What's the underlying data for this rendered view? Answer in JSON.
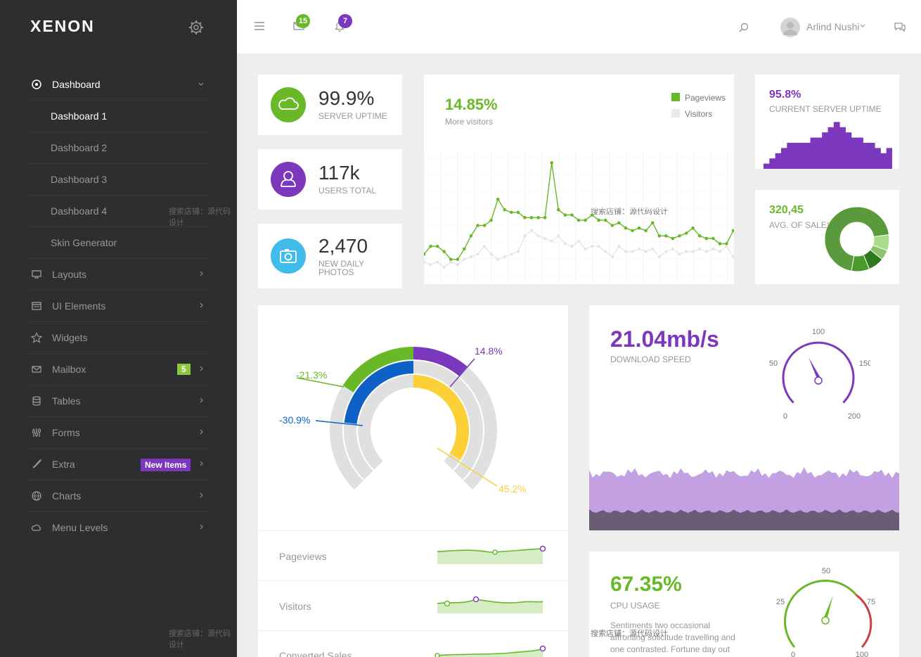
{
  "brand": {
    "logo": "XENON"
  },
  "sidebar": {
    "items": [
      {
        "label": "Dashboard",
        "icon": "gauge-icon"
      },
      {
        "label": "Dashboard 1"
      },
      {
        "label": "Dashboard 2"
      },
      {
        "label": "Dashboard 3"
      },
      {
        "label": "Dashboard 4"
      },
      {
        "label": "Skin Generator"
      },
      {
        "label": "Layouts",
        "icon": "monitor-icon"
      },
      {
        "label": "UI Elements",
        "icon": "window-icon"
      },
      {
        "label": "Widgets",
        "icon": "star-icon"
      },
      {
        "label": "Mailbox",
        "icon": "envelope-icon",
        "badge": "5"
      },
      {
        "label": "Tables",
        "icon": "database-icon"
      },
      {
        "label": "Forms",
        "icon": "sliders-icon"
      },
      {
        "label": "Extra",
        "icon": "rocket-icon",
        "badge": "New Items"
      },
      {
        "label": "Charts",
        "icon": "globe-icon"
      },
      {
        "label": "Menu Levels",
        "icon": "cloud-icon"
      }
    ]
  },
  "topbar": {
    "mail_count": "15",
    "bell_count": "7",
    "user_name": "Arlind Nushi"
  },
  "stats": {
    "uptime": {
      "value": "99.9%",
      "label": "SERVER UPTIME"
    },
    "users": {
      "value": "117k",
      "label": "USERS TOTAL"
    },
    "photos": {
      "value": "2,470",
      "label1": "NEW DAILY",
      "label2": "PHOTOS"
    }
  },
  "visitors_chart": {
    "pct": "14.85%",
    "sub": "More visitors",
    "legend": [
      "Pageviews",
      "Visitors"
    ]
  },
  "server_uptime": {
    "pct": "95.8%",
    "label": "CURRENT SERVER UPTIME"
  },
  "sales": {
    "value": "320,45",
    "label": "AVG. OF SALES"
  },
  "radial": {
    "labels": [
      "-21.3%",
      "14.8%",
      "-30.9%",
      "45.2%"
    ]
  },
  "sparks": {
    "rows": [
      "Pageviews",
      "Visitors",
      "Converted Sales"
    ]
  },
  "download": {
    "value": "21.04mb/s",
    "label": "DOWNLOAD SPEED",
    "ticks": [
      "100",
      "50",
      "150",
      "0",
      "200"
    ]
  },
  "cpu": {
    "value": "67.35%",
    "label": "CPU USAGE",
    "text": "Sentiments two occasional affronting solicitude travelling and one contrasted. Fortune day out",
    "ticks": [
      "50",
      "25",
      "75",
      "0",
      "100"
    ]
  },
  "watermark": "搜索店铺：源代码设计",
  "colors": {
    "green": "#68b828",
    "purple": "#7c38bc",
    "blue": "#0e62c7",
    "yellow": "#fcd036",
    "cyan": "#40bbea"
  },
  "chart_data": [
    {
      "type": "line",
      "series": [
        {
          "name": "Pageviews",
          "values": [
            23,
            26,
            26,
            24,
            21,
            21,
            25,
            30,
            34,
            34,
            36,
            44,
            40,
            39,
            39,
            37,
            37,
            37,
            37,
            58,
            40,
            38,
            38,
            36,
            36,
            38,
            36,
            36,
            34,
            35,
            33,
            32,
            33,
            32,
            35,
            30,
            30,
            29,
            30,
            31,
            33,
            30,
            29,
            29,
            27,
            27,
            32
          ]
        },
        {
          "name": "Visitors",
          "values": [
            20,
            19,
            20,
            18,
            20,
            19,
            21,
            22,
            23,
            26,
            23,
            21,
            22,
            23,
            24,
            30,
            32,
            30,
            29,
            28,
            30,
            27,
            26,
            28,
            25,
            26,
            26,
            24,
            22,
            26,
            24,
            24,
            25,
            24,
            25,
            22,
            24,
            25,
            23,
            24,
            24,
            25,
            24,
            25,
            24,
            26,
            22
          ]
        }
      ]
    },
    {
      "type": "bar",
      "values": [
        10,
        20,
        30,
        40,
        50,
        50,
        50,
        50,
        60,
        60,
        70,
        80,
        90,
        80,
        70,
        60,
        60,
        50,
        50,
        40,
        30,
        40
      ]
    },
    {
      "type": "pie",
      "values": [
        70,
        8,
        5,
        8,
        9
      ]
    },
    {
      "type": "bar",
      "series": [
        {
          "name": "-21.3%",
          "values": [
            -21.3
          ]
        },
        {
          "name": "14.8%",
          "values": [
            14.8
          ]
        },
        {
          "name": "-30.9%",
          "values": [
            -30.9
          ]
        },
        {
          "name": "45.2%",
          "values": [
            45.2
          ]
        }
      ]
    }
  ]
}
